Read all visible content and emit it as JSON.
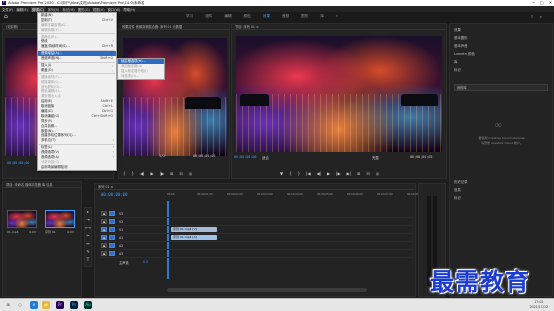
{
  "titlebar": {
    "app_icon": "Pr",
    "title": "Adobe Premiere Pro 2020 - C:\\用户\\Idea\\文档\\Adobe\\Premiere Pro\\14.0\\未命名",
    "minimize": "─",
    "maximize": "□",
    "close": "✕"
  },
  "menubar": [
    "文件(F)",
    "编辑(E)",
    "剪辑(C)",
    "序列(S)",
    "标记(M)",
    "图形(G)",
    "视图(V)",
    "窗口(W)",
    "帮助(H)"
  ],
  "workspace": {
    "tabs": [
      "学习",
      "组件",
      "编辑",
      "颜色",
      "效果",
      "音频",
      "图形",
      "库"
    ],
    "active_index": 4,
    "more": "»"
  },
  "source_panel": {
    "title": "(无剪辑)",
    "icons": "≡",
    "tc_left": "00;00;00;00",
    "tc_right": "00;00;04;03",
    "fit": "1/2"
  },
  "middle_panel": {
    "title": "效果控件  音频剪辑混合器: 序列 01  元数据",
    "fit": "1/2",
    "tc_right": "00;00;04;03"
  },
  "program_panel": {
    "title": "节目: 序列 01  ≡",
    "tc_left": "00;00;00;00",
    "fit": "适合",
    "quality": "完整",
    "tc_right": "00;00;04;03"
  },
  "dropdown": {
    "items": [
      {
        "label": "新建(N)",
        "key": "",
        "arrow": "›",
        "disabled": false
      },
      {
        "label": "复制(T)",
        "key": "Ctrl+V",
        "disabled": false
      },
      {
        "label": "编辑字幕剪辑(E)...",
        "key": "",
        "disabled": true
      },
      {
        "label": "编辑剪辑(Y)...",
        "key": "",
        "disabled": true
      },
      {
        "sep": true
      },
      {
        "label": "重命名(R)...",
        "key": "",
        "disabled": true
      },
      {
        "label": "修改",
        "key": "",
        "arrow": "›",
        "disabled": false
      },
      {
        "label": "速度/持续时间(S)...",
        "key": "Ctrl+R",
        "disabled": false
      },
      {
        "sep": true
      },
      {
        "label": "音频增益(A)...",
        "key": "G",
        "disabled": false
      },
      {
        "label": "音频声道(N)...",
        "key": "Shift+G",
        "disabled": false
      },
      {
        "sep": true
      },
      {
        "label": "插入(I)",
        "key": ",",
        "disabled": false
      },
      {
        "label": "覆盖(O)",
        "key": ".",
        "disabled": false
      },
      {
        "sep": true
      },
      {
        "label": "替换素材(F)...",
        "key": "",
        "disabled": true
      },
      {
        "label": "链接媒体(L)...",
        "key": "",
        "disabled": true
      },
      {
        "label": "设为脱机(O)...",
        "key": "",
        "disabled": true
      },
      {
        "label": "脱机编辑(E)...",
        "key": "",
        "disabled": true
      },
      {
        "label": "源剪辑出入点",
        "key": "",
        "disabled": true
      },
      {
        "label": "启用(E)",
        "key": "Shift+E",
        "disabled": false
      },
      {
        "label": "取消链接",
        "key": "Ctrl+L",
        "disabled": false
      },
      {
        "label": "编组(G)",
        "key": "Ctrl+G",
        "disabled": false
      },
      {
        "label": "取消编组(U)",
        "key": "Ctrl+Shift+G",
        "disabled": false
      },
      {
        "label": "同步(Y)",
        "key": "",
        "disabled": false
      },
      {
        "label": "合并剪辑...",
        "key": "",
        "disabled": false
      },
      {
        "label": "嵌套(N)...",
        "key": "",
        "disabled": false
      },
      {
        "label": "创建多机位源序列(Q)...",
        "key": "",
        "disabled": false
      },
      {
        "label": "多机位(T)",
        "key": "",
        "arrow": "›",
        "disabled": false
      },
      {
        "sep": true
      },
      {
        "label": "标签(L)",
        "key": "",
        "arrow": "›",
        "disabled": false
      },
      {
        "label": "视频选项(V)",
        "key": "",
        "arrow": "›",
        "disabled": false
      },
      {
        "label": "音频选项(A)",
        "key": "",
        "arrow": "›",
        "disabled": false
      },
      {
        "label": "分析内容(C)...",
        "key": "",
        "disabled": true
      },
      {
        "label": "启用场景编辑检测",
        "key": "",
        "disabled": false
      }
    ],
    "highlighted_index": 9
  },
  "submenu": {
    "items": [
      {
        "label": "帧定格选项(H)...",
        "key": "",
        "hl": true
      },
      {
        "label": "添加帧定格(A)",
        "key": "",
        "disabled": true
      },
      {
        "label": "插入帧定格分段(I)",
        "key": "",
        "disabled": true
      },
      {
        "label": "场选项(O)...",
        "key": "",
        "disabled": true
      }
    ]
  },
  "project_panel": {
    "title": "项目: 未命名  媒体浏览器  库  信息",
    "clip1_name": "01.mp4",
    "clip1_dur": "4:03",
    "clip2_name": "序列 01",
    "clip2_dur": "4:03"
  },
  "timeline": {
    "header": "序列 01  ≡",
    "timecode": "00;00;00;00",
    "ruler": [
      "00;00",
      "00;00;01;00",
      "00;00;02;00",
      "00;00;03;00",
      "00;00;04;00",
      "00;00;05;00",
      "00;00;06;00",
      "00;00;07;00",
      "00;00;08;00"
    ],
    "video_tracks": [
      "V3",
      "V2",
      "V1"
    ],
    "audio_tracks": [
      "A1",
      "A2",
      "A3"
    ],
    "master": "主声道",
    "master_val": "0.0",
    "v_clip": "序列 01.mp4 [V]",
    "a_clip": "序列 01.mp4 [A]"
  },
  "right_panel": {
    "top_items": [
      "效果",
      "基本图形",
      "基本声音",
      "Lumetri 颜色",
      "库",
      "标记"
    ],
    "dropdown_label": "我的库",
    "cc_message_1": "要使用 Creative Cloud Libraries,",
    "cc_message_2": "请登录 Creative Cloud 帐户。",
    "bottom_items": [
      "历史记录",
      "信息",
      "标记"
    ]
  },
  "taskbar": {
    "time": "17:02",
    "date": "2021/11/12",
    "icons": [
      "⊞",
      "○",
      "e",
      "📁",
      "Pr",
      "Ps",
      "Au"
    ]
  },
  "watermark": "最需教育",
  "colors": {
    "accent": "#3f9cff",
    "menu_highlight": "#2f6cc4",
    "audio_clip": "#9fc2ea",
    "video_clip": "#a8b8d8"
  }
}
